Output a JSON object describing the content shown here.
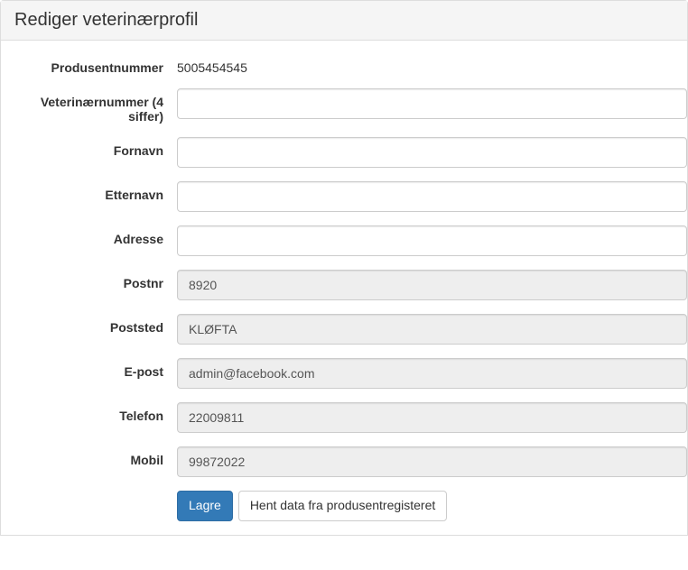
{
  "header": {
    "title": "Rediger veterinærprofil"
  },
  "labels": {
    "produsentnummer": "Produsentnummer",
    "veterinaernummer": "Veterinærnummer (4 siffer)",
    "fornavn": "Fornavn",
    "etternavn": "Etternavn",
    "adresse": "Adresse",
    "postnr": "Postnr",
    "poststed": "Poststed",
    "epost": "E-post",
    "telefon": "Telefon",
    "mobil": "Mobil"
  },
  "values": {
    "produsentnummer": "5005454545",
    "veterinaernummer": "",
    "fornavn": "",
    "etternavn": "",
    "adresse": "",
    "postnr": "8920",
    "poststed": "KLØFTA",
    "epost": "admin@facebook.com",
    "telefon": "22009811",
    "mobil": "99872022"
  },
  "buttons": {
    "save": "Lagre",
    "fetch": "Hent data fra produsentregisteret"
  }
}
